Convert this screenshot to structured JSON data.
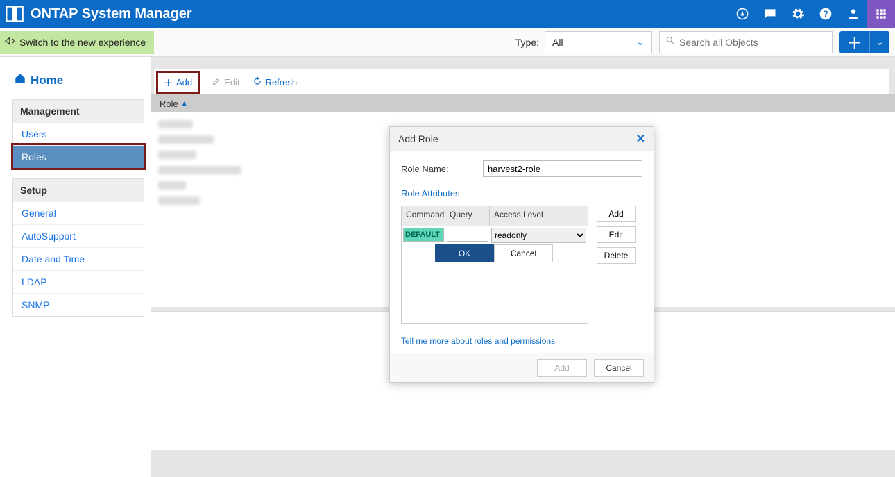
{
  "header": {
    "app_title": "ONTAP System Manager"
  },
  "sub_header": {
    "switch_banner": "Switch to the new experience",
    "type_label": "Type:",
    "type_value": "All",
    "search_placeholder": "Search all Objects"
  },
  "sidebar": {
    "home": "Home",
    "sections": {
      "management": {
        "title": "Management",
        "items": {
          "users": "Users",
          "roles": "Roles"
        }
      },
      "setup": {
        "title": "Setup",
        "items": {
          "general": "General",
          "autosupport": "AutoSupport",
          "date_time": "Date and Time",
          "ldap": "LDAP",
          "snmp": "SNMP"
        }
      }
    }
  },
  "toolbar": {
    "add": "Add",
    "edit": "Edit",
    "refresh": "Refresh"
  },
  "table": {
    "column_role": "Role",
    "sort_arrow": "▲"
  },
  "dialog": {
    "title": "Add Role",
    "close": "✕",
    "role_name_label": "Role Name:",
    "role_name_value": "harvest2-role",
    "role_attributes": "Role Attributes",
    "columns": {
      "command": "Command",
      "query": "Query",
      "access": "Access Level"
    },
    "row": {
      "command": "DEFAULT",
      "query": "",
      "access": "readonly"
    },
    "ok": "OK",
    "row_cancel": "Cancel",
    "side_buttons": {
      "add": "Add",
      "edit": "Edit",
      "delete": "Delete"
    },
    "tell_more": "Tell me more about roles and permissions",
    "footer": {
      "add": "Add",
      "cancel": "Cancel"
    }
  }
}
